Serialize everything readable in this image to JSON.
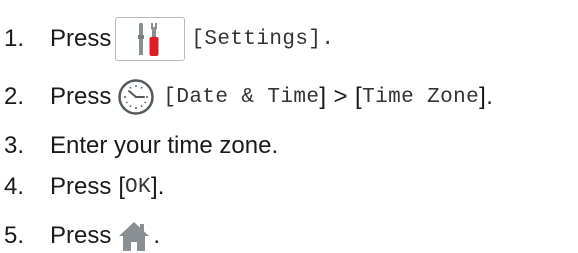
{
  "steps": [
    {
      "number": "1.",
      "press": "Press",
      "bracket_open": "[",
      "settings_label": "Settings",
      "bracket_close": "]."
    },
    {
      "number": "2.",
      "press": "Press",
      "bracket_open_1": "[",
      "date_time_label": "Date & Time",
      "bracket_close_sep": "] > [",
      "time_zone_label": "Time Zone",
      "bracket_close": "]."
    },
    {
      "number": "3.",
      "text": "Enter your time zone."
    },
    {
      "number": "4.",
      "press": "Press",
      "bracket_open": "[",
      "ok_label": "OK",
      "bracket_close": "]."
    },
    {
      "number": "5.",
      "press": "Press",
      "period": "."
    }
  ],
  "icons": {
    "settings": "settings-tools-icon",
    "clock": "clock-icon",
    "home": "home-icon"
  },
  "colors": {
    "settings_red": "#d92027",
    "icon_gray": "#8a8f94",
    "text": "#1a1a1a"
  }
}
